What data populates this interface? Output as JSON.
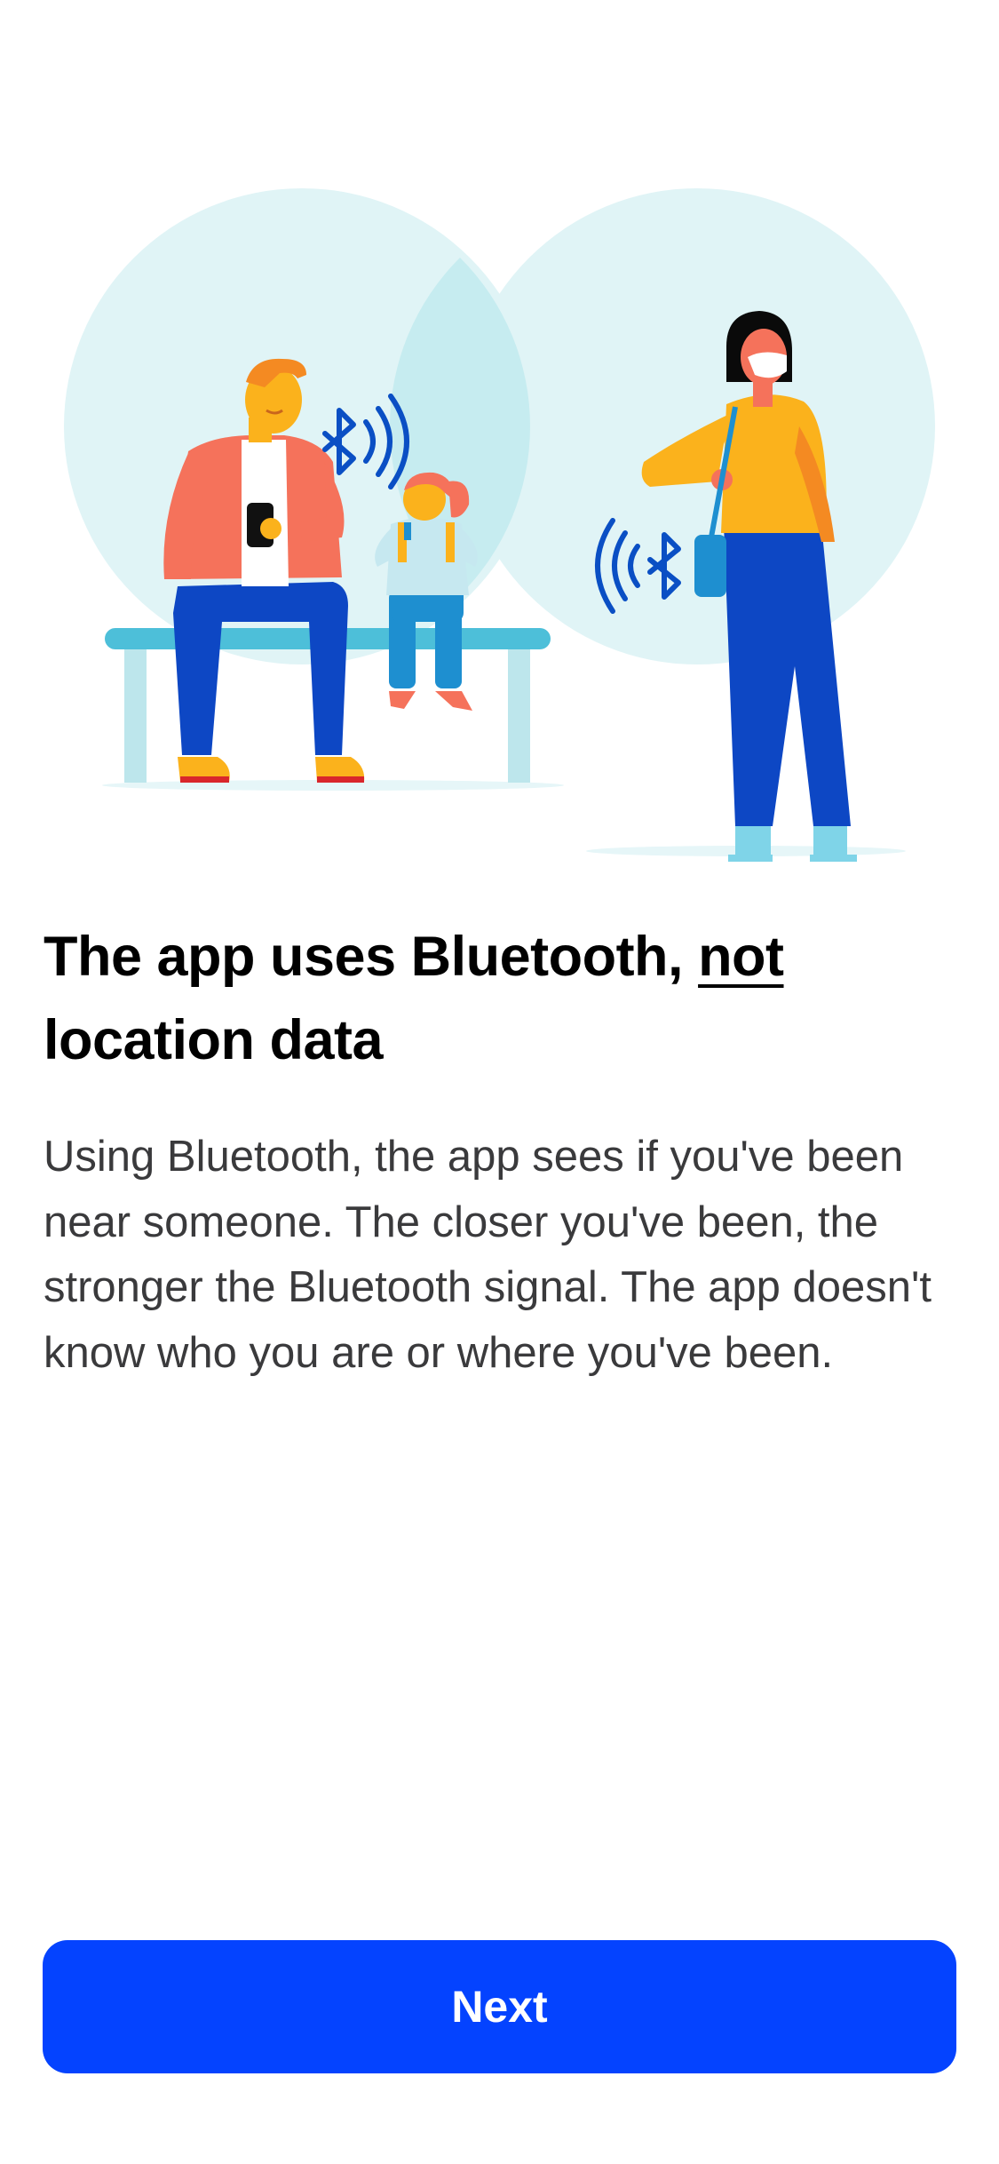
{
  "illustration": {
    "icon": "bluetooth-illustration",
    "description_alt": ""
  },
  "heading": {
    "prefix": "The app uses Bluetooth, ",
    "emphasis": "not",
    "suffix": " location data"
  },
  "body": {
    "text": "Using Bluetooth, the app sees if you've been near someone. The closer you've been, the stronger the Bluetooth signal. The app doesn't know who you are or where you've been."
  },
  "actions": {
    "next_label": "Next"
  },
  "colors": {
    "accent": "#0443ff",
    "circle": "#e0f4f6",
    "bench": "#4dbfd9",
    "bluetooth": "#0a4fc4",
    "shirt_orange": "#f5725b",
    "pants_blue": "#0d47c4",
    "yellow": "#fbb21c"
  }
}
